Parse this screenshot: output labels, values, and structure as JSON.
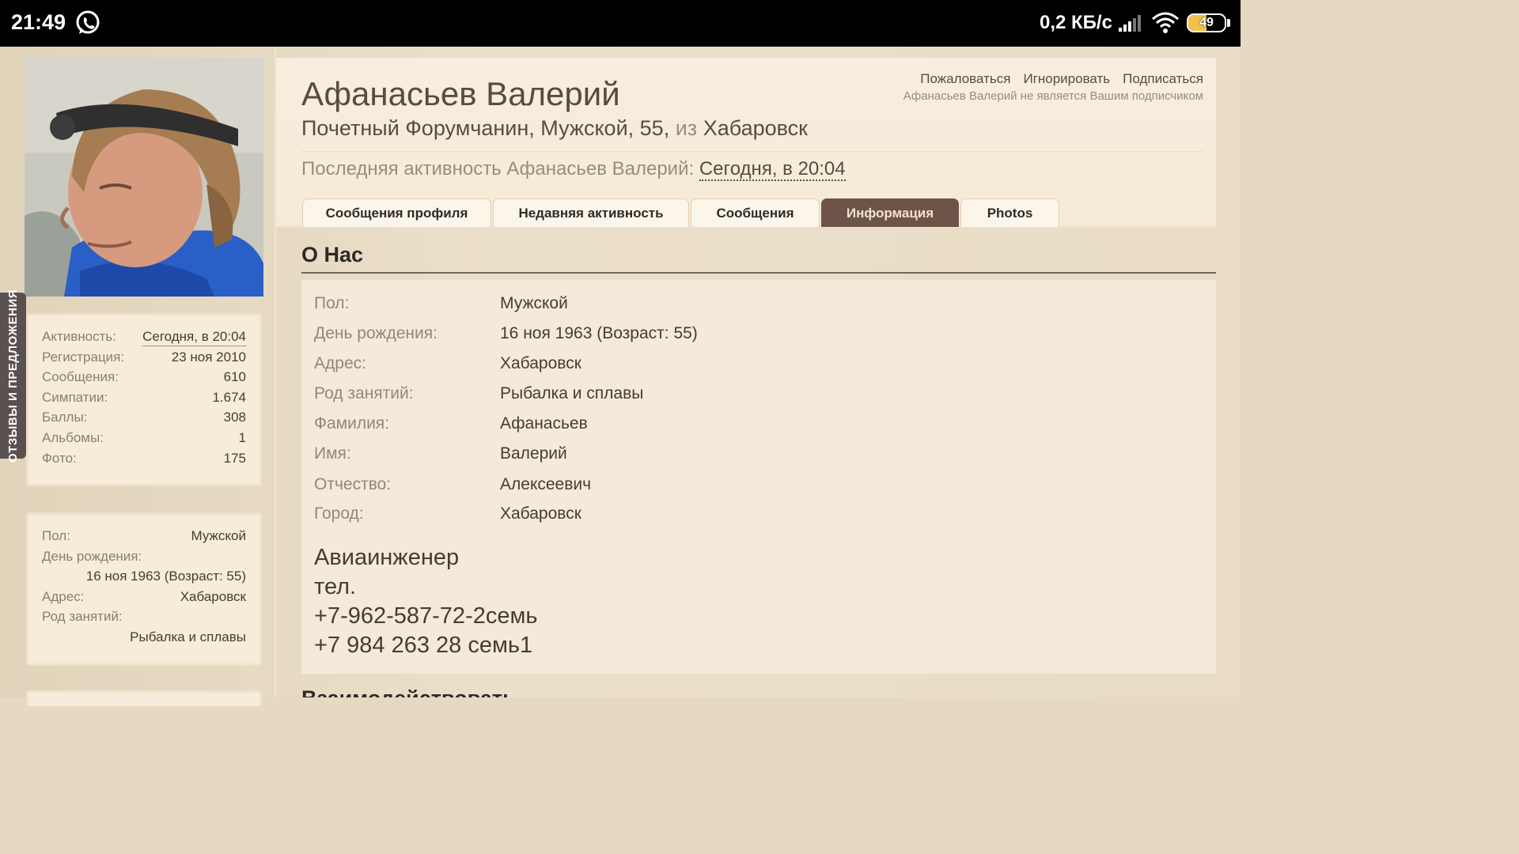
{
  "status_bar": {
    "time": "21:49",
    "speed": "0,2 КБ/с",
    "battery": "49",
    "battery_percent": 49,
    "icons": [
      "whatsapp-icon",
      "signal-icon",
      "wifi-icon",
      "battery-icon"
    ]
  },
  "feedback_tab": {
    "label": "ОТЗЫВЫ И ПРЕДЛОЖЕНИЯ"
  },
  "profile": {
    "name": "Афанасьев Валерий",
    "title_main": "Почетный Форумчанин, Мужской, 55,",
    "title_from": "из",
    "title_city": "Хабаровск",
    "last_activity_label": "Последняя активность Афанасьев Валерий:",
    "last_activity_time": "Сегодня, в 20:04"
  },
  "header_links": {
    "report": "Пожаловаться",
    "ignore": "Игнорировать",
    "follow": "Подписаться",
    "follow_note": "Афанасьев Валерий не является Вашим подписчиком"
  },
  "tabs": [
    {
      "label": "Сообщения профиля",
      "active": false
    },
    {
      "label": "Недавняя активность",
      "active": false
    },
    {
      "label": "Сообщения",
      "active": false
    },
    {
      "label": "Информация",
      "active": true
    },
    {
      "label": "Photos",
      "active": false
    }
  ],
  "stats": [
    {
      "label": "Активность:",
      "value": "Сегодня, в 20:04"
    },
    {
      "label": "Регистрация:",
      "value": "23 ноя 2010"
    },
    {
      "label": "Сообщения:",
      "value": "610"
    },
    {
      "label": "Симпатии:",
      "value": "1.674"
    },
    {
      "label": "Баллы:",
      "value": "308"
    },
    {
      "label": "Альбомы:",
      "value": "1"
    },
    {
      "label": "Фото:",
      "value": "175"
    }
  ],
  "side_info": {
    "gender_label": "Пол:",
    "gender_value": "Мужской",
    "birthday_label": "День рождения:",
    "birthday_value": "16 ноя 1963 (Возраст: 55)",
    "address_label": "Адрес:",
    "address_value": "Хабаровск",
    "occupation_label": "Род занятий:",
    "occupation_value": "Рыбалка и сплавы"
  },
  "about": {
    "title": "О Нас",
    "rows": [
      {
        "label": "Пол:",
        "value": "Мужской"
      },
      {
        "label": "День рождения:",
        "value": "16 ноя 1963 (Возраст: 55)"
      },
      {
        "label": "Адрес:",
        "value": "Хабаровск"
      },
      {
        "label": "Род занятий:",
        "value": "Рыбалка и сплавы"
      },
      {
        "label": "Фамилия:",
        "value": "Афанасьев"
      },
      {
        "label": "Имя:",
        "value": "Валерий"
      },
      {
        "label": "Отчество:",
        "value": "Алексеевич"
      },
      {
        "label": "Город:",
        "value": "Хабаровск"
      }
    ],
    "free_text": [
      "Авиаинженер",
      "тел.",
      "+7-962-587-72-2семь",
      "+7 984 263 28 семь1"
    ]
  },
  "next_section_title": "Взаимодействовать"
}
